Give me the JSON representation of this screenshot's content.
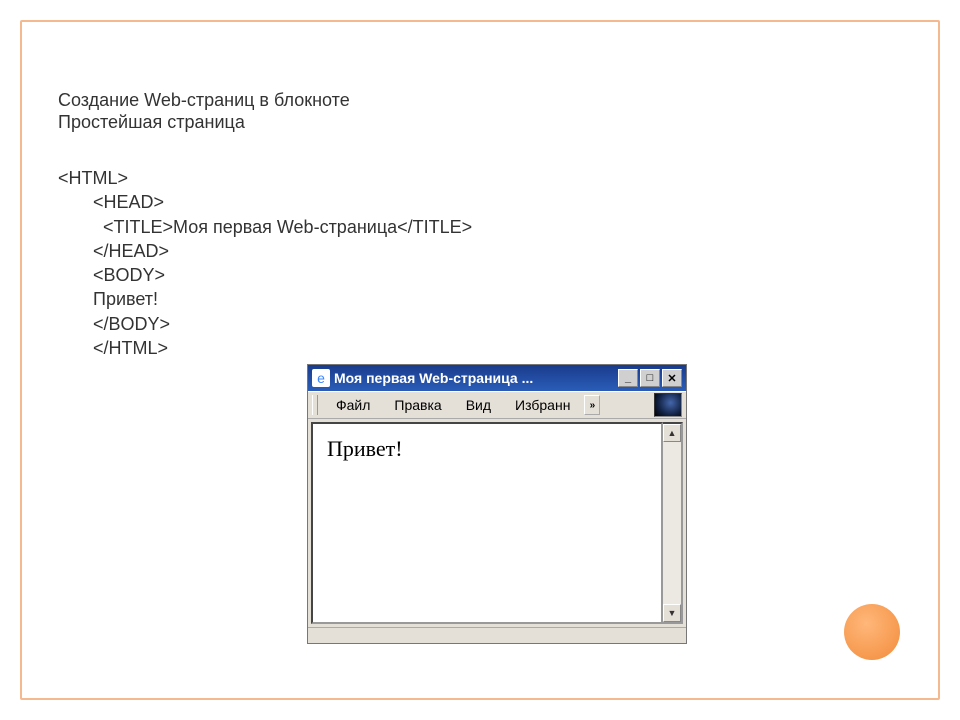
{
  "heading": {
    "line1": "Создание Web-страниц в блокноте",
    "line2": "Простейшая страница"
  },
  "code": {
    "l1": "<HTML>",
    "l2": "       <HEAD>",
    "l3": "         <TITLE>Моя первая Web-страница</TITLE>",
    "l4": "       </HEAD>",
    "l5": "       <BODY>",
    "l6": "       Привет!",
    "l7": "       </BODY>",
    "l8": "       </HTML>"
  },
  "browser": {
    "title": "Моя первая Web-страница ...",
    "menu": {
      "file": "Файл",
      "edit": "Правка",
      "view": "Вид",
      "favorites": "Избранн",
      "expand": "»"
    },
    "page_content": "Привет!",
    "btn_min": "_",
    "btn_max": "□",
    "btn_close": "✕",
    "scroll_up": "▲",
    "scroll_down": "▼"
  }
}
